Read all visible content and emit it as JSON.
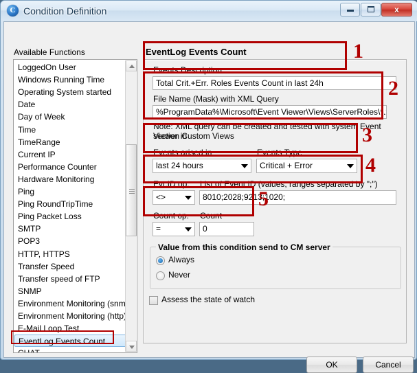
{
  "window": {
    "title": "Condition Definition",
    "icon": "app-icon",
    "buttons": {
      "minimize": "minimize-icon",
      "maximize": "maximize-icon",
      "close": "x"
    }
  },
  "left": {
    "label": "Available Functions",
    "items": [
      "LoggedOn User",
      "Windows Running Time",
      "Operating System started",
      "Date",
      "Day of Week",
      "Time",
      "TimeRange",
      "Current IP",
      "Performance Counter",
      "Hardware Monitoring",
      "Ping",
      "Ping RoundTripTime",
      "Ping Packet Loss",
      "SMTP",
      "POP3",
      "HTTP, HTTPS",
      "Transfer Speed",
      "Transfer speed of FTP",
      "SNMP",
      "Environment Monitoring (snmp)",
      "Environment Monitoring (http)",
      "E-Mail Loop Test",
      "EventLog Events Count",
      "CHAT"
    ],
    "selected_index": 22
  },
  "panel": {
    "title": "EventLog Events Count",
    "description": {
      "label": "Events Description",
      "value": "Total Crit.+Err. Roles Events Count  in last 24h"
    },
    "file_mask": {
      "label": "File Name (Mask) with XML Query",
      "value": "%ProgramData%\\Microsoft\\Event Viewer\\Views\\ServerRoles\\*.xml",
      "note_line1": "Note: XML query can be created and tested with system Event Viewer in",
      "note_line2": "section Custom Views"
    },
    "arised_in": {
      "label": "Events arised in",
      "value": "last 24 hours"
    },
    "events_type": {
      "label": "Events Type",
      "value": "Critical + Error"
    },
    "evtid_op": {
      "label": "Evt.ID op.",
      "value": "<>"
    },
    "evtid_list": {
      "label": "List of Event ID (values, ranges separated by \";\")",
      "value": "8010;2028;9213;1020;"
    },
    "count_op": {
      "label": "Count op.",
      "value": "="
    },
    "count": {
      "label": "Count",
      "value": "0"
    },
    "group": {
      "title": "Value from this condition send to CM server",
      "option_always": "Always",
      "option_never": "Never",
      "selected": "Always"
    },
    "assess_checkbox": {
      "label": "Assess the state of watch",
      "checked": false
    }
  },
  "footer": {
    "ok": "OK",
    "cancel": "Cancel"
  },
  "annotations": {
    "n1": "1",
    "n2": "2",
    "n3": "3",
    "n4": "4",
    "n5": "5"
  },
  "colors": {
    "annotation_red": "#b00000",
    "accent_blue": "#1466ab",
    "dialog_bg": "#f0f0f0"
  }
}
